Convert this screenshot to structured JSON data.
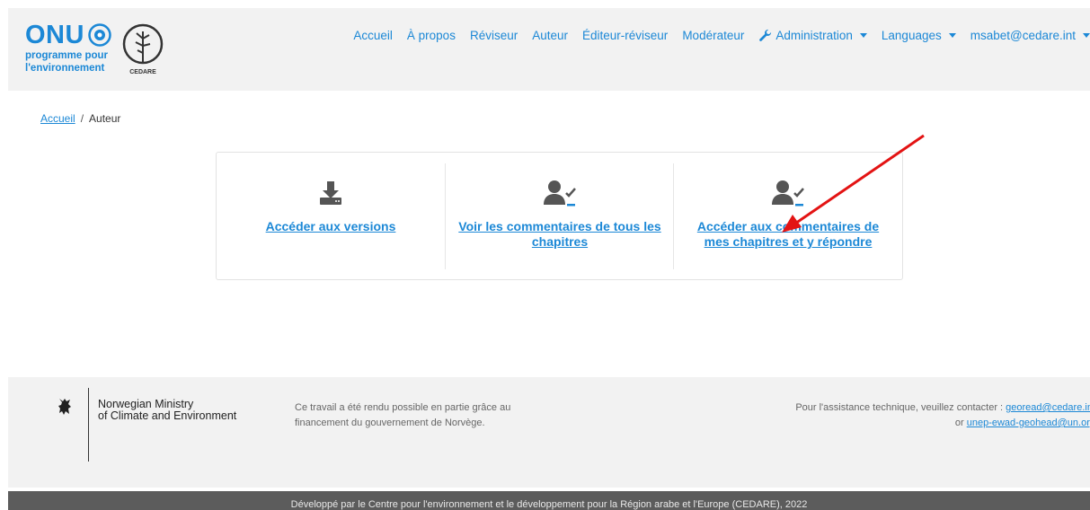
{
  "header": {
    "logo_onu": "ONU",
    "logo_sub_line1": "programme pour",
    "logo_sub_line2": "l'environnement",
    "logo_cedare": "CEDARE",
    "nav": {
      "accueil": "Accueil",
      "apropos": "À propos",
      "reviseur": "Réviseur",
      "auteur": "Auteur",
      "editeur_reviseur": "Éditeur-réviseur",
      "moderateur": "Modérateur",
      "administration": "Administration",
      "languages": "Languages",
      "user": "msabet@cedare.int"
    }
  },
  "breadcrumb": {
    "home": "Accueil",
    "separator": "/",
    "current": "Auteur"
  },
  "cards": {
    "versions": "Accéder aux versions",
    "all_comments": "Voir les commentaires de tous les chapitres",
    "my_comments": "Accéder aux commentaires de mes chapitres et y répondre"
  },
  "footer": {
    "ministry_line1": "Norwegian Ministry",
    "ministry_line2": "of Climate and Environment",
    "funding_line1": "Ce travail a été rendu possible en partie grâce au",
    "funding_line2": "financement du gouvernement de Norvège.",
    "support_prefix": "Pour l'assistance technique, veuillez contacter : ",
    "support_email1": "georead@cedare.int",
    "support_or": "or ",
    "support_email2": "unep-ewad-geohead@un.org",
    "bottom_text": "Développé par le Centre pour l'environnement et le développement pour la Région arabe et l'Europe (CEDARE), 2022"
  },
  "colors": {
    "link": "#1c88d6",
    "header_bg": "#f2f2f2",
    "bottom_bar": "#5c5c5c",
    "annotation_arrow": "#e31313"
  },
  "icons": [
    "un-emblem-icon",
    "cedare-tree-icon",
    "wrench-icon",
    "download-icon",
    "user-check-icon",
    "norway-lion-icon",
    "red-arrow-annotation"
  ]
}
